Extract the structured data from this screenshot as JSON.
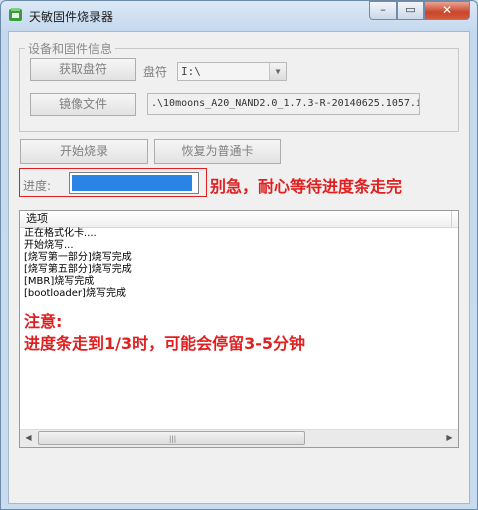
{
  "window": {
    "title": "天敏固件烧录器",
    "close_glyph": "✕",
    "min_glyph": "–",
    "max_glyph": "▭",
    "accent": "#2a84e6",
    "warn_color": "#e02020"
  },
  "group": {
    "legend": "设备和固件信息"
  },
  "buttons": {
    "get_drive": "获取盘符",
    "image_file": "镜像文件",
    "start": "开始烧录",
    "restore": "恢复为普通卡"
  },
  "drive": {
    "label": "盘符",
    "selected": "I:\\"
  },
  "image": {
    "path": ".\\10moons_A20_NAND2.0_1.7.3-R-20140625.1057.i"
  },
  "progress": {
    "label": "进度:",
    "percent": 97
  },
  "warning": "别急，耐心等待进度条走完",
  "log": {
    "column": "选项",
    "lines": [
      "正在格式化卡....",
      "开始烧写...",
      "[烧写第一部分]烧写完成",
      "[烧写第五部分]烧写完成",
      "[MBR]烧写完成",
      "[bootloader]烧写完成"
    ],
    "note_title": "注意:",
    "note_body": "进度条走到1/3时，可能会停留3-5分钟"
  }
}
